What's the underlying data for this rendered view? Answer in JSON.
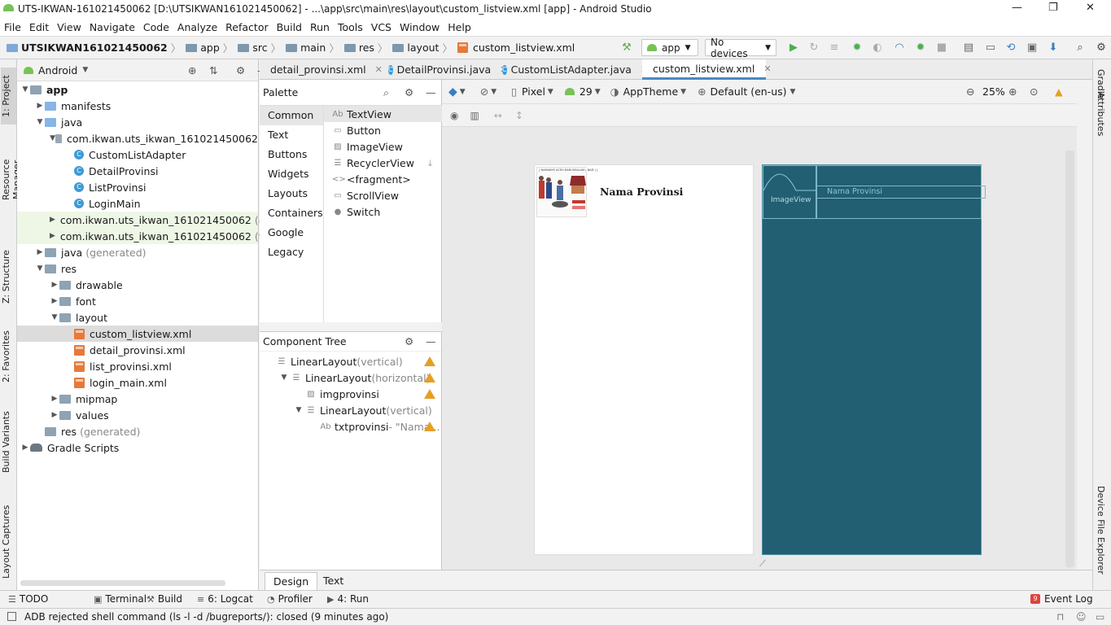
{
  "window": {
    "title": "UTS-IKWAN-161021450062 [D:\\UTSIKWAN161021450062] - ...\\app\\src\\main\\res\\layout\\custom_listview.xml [app] - Android Studio"
  },
  "menu": [
    "File",
    "Edit",
    "View",
    "Navigate",
    "Code",
    "Analyze",
    "Refactor",
    "Build",
    "Run",
    "Tools",
    "VCS",
    "Window",
    "Help"
  ],
  "breadcrumb": {
    "project": "UTSIKWAN161021450062",
    "parts": [
      "app",
      "src",
      "main",
      "res",
      "layout"
    ],
    "file": "custom_listview.xml"
  },
  "toolbar": {
    "run_config": "app",
    "device": "No devices"
  },
  "left_strip": [
    "1: Project",
    "Resource Manager",
    "Z: Structure",
    "2: Favorites",
    "Build Variants",
    "Layout Captures"
  ],
  "right_strip": [
    "Gradle",
    "Attributes",
    "Device File Explorer"
  ],
  "project": {
    "view_mode": "Android",
    "tree": [
      {
        "label": "app",
        "kind": "module",
        "indent": 0,
        "open": true
      },
      {
        "label": "manifests",
        "kind": "folder",
        "indent": 1,
        "open": false
      },
      {
        "label": "java",
        "kind": "folder",
        "indent": 1,
        "open": true
      },
      {
        "label": "com.ikwan.uts_ikwan_161021450062",
        "kind": "pkg",
        "indent": 2,
        "open": true
      },
      {
        "label": "CustomListAdapter",
        "kind": "class",
        "indent": 3
      },
      {
        "label": "DetailProvinsi",
        "kind": "class",
        "indent": 3
      },
      {
        "label": "ListProvinsi",
        "kind": "class",
        "indent": 3
      },
      {
        "label": "LoginMain",
        "kind": "class",
        "indent": 3
      },
      {
        "label": "com.ikwan.uts_ikwan_161021450062",
        "suffix": "(andr",
        "kind": "pkg",
        "indent": 2,
        "open": false,
        "green": true
      },
      {
        "label": "com.ikwan.uts_ikwan_161021450062",
        "suffix": "(test)",
        "kind": "pkg",
        "indent": 2,
        "open": false,
        "green": true
      },
      {
        "label": "java",
        "suffix": "(generated)",
        "kind": "folder",
        "indent": 1,
        "open": false
      },
      {
        "label": "res",
        "kind": "folder",
        "indent": 1,
        "open": true
      },
      {
        "label": "drawable",
        "kind": "folder",
        "indent": 2,
        "open": false
      },
      {
        "label": "font",
        "kind": "folder",
        "indent": 2,
        "open": false
      },
      {
        "label": "layout",
        "kind": "folder",
        "indent": 2,
        "open": true
      },
      {
        "label": "custom_listview.xml",
        "kind": "xml",
        "indent": 3,
        "selected": true
      },
      {
        "label": "detail_provinsi.xml",
        "kind": "xml",
        "indent": 3
      },
      {
        "label": "list_provinsi.xml",
        "kind": "xml",
        "indent": 3
      },
      {
        "label": "login_main.xml",
        "kind": "xml",
        "indent": 3
      },
      {
        "label": "mipmap",
        "kind": "folder",
        "indent": 2,
        "open": false
      },
      {
        "label": "values",
        "kind": "folder",
        "indent": 2,
        "open": false
      },
      {
        "label": "res",
        "suffix": "(generated)",
        "kind": "folder",
        "indent": 1,
        "leaf": true
      },
      {
        "label": "Gradle Scripts",
        "kind": "gradle",
        "indent": 0,
        "open": false
      }
    ]
  },
  "editor_tabs": [
    {
      "label": "detail_provinsi.xml",
      "kind": "xml"
    },
    {
      "label": "DetailProvinsi.java",
      "kind": "class"
    },
    {
      "label": "CustomListAdapter.java",
      "kind": "class"
    },
    {
      "label": "custom_listview.xml",
      "kind": "xml",
      "active": true
    }
  ],
  "palette": {
    "title": "Palette",
    "categories": [
      "Common",
      "Text",
      "Buttons",
      "Widgets",
      "Layouts",
      "Containers",
      "Google",
      "Legacy"
    ],
    "items": [
      {
        "label": "TextView",
        "icon": "Ab"
      },
      {
        "label": "Button",
        "icon": "▭"
      },
      {
        "label": "ImageView",
        "icon": "▨"
      },
      {
        "label": "RecyclerView",
        "icon": "☰"
      },
      {
        "label": "<fragment>",
        "icon": "<>"
      },
      {
        "label": "ScrollView",
        "icon": "▭"
      },
      {
        "label": "Switch",
        "icon": "●"
      }
    ]
  },
  "component_tree": {
    "title": "Component Tree",
    "items": [
      {
        "name": "LinearLayout",
        "extra": "(vertical)",
        "indent": 0,
        "warn": true
      },
      {
        "name": "LinearLayout",
        "extra": "(horizontal)",
        "indent": 1,
        "warn": true,
        "open": true
      },
      {
        "name": "imgprovinsi",
        "extra": "",
        "indent": 2,
        "warn": true
      },
      {
        "name": "LinearLayout",
        "extra": "(vertical)",
        "indent": 2,
        "open": true
      },
      {
        "name": "txtprovinsi",
        "extra": "- \"Nama...",
        "indent": 3,
        "warn": true
      }
    ]
  },
  "design_toolbar": {
    "device": "Pixel",
    "api": "29",
    "theme": "AppTheme",
    "locale": "Default (en-us)",
    "zoom": "25%"
  },
  "preview": {
    "text": "Nama Provinsi",
    "blueprint_image_label": "ImageView",
    "blueprint_text": "Nama Provinsi",
    "thumbnail_caption": "[ NAMANYE ACEH DARUSSALAM ( NAD ) ]"
  },
  "bottom_tabs": [
    "Design",
    "Text"
  ],
  "tool_windows": [
    {
      "label": "TODO",
      "icon": "☰"
    },
    {
      "label": "Terminal",
      "icon": "▣"
    },
    {
      "label": "Build",
      "icon": "⚒"
    },
    {
      "label": "6: Logcat",
      "icon": "≡"
    },
    {
      "label": "Profiler",
      "icon": "◔"
    },
    {
      "label": "4: Run",
      "icon": "▶"
    }
  ],
  "event_log": {
    "count": "9",
    "label": "Event Log"
  },
  "status": "ADB rejected shell command (ls -l -d /bugreports/): closed (9 minutes ago)",
  "colors": {
    "blueprint": "#225f73",
    "accent": "#4a88c7",
    "warn": "#e5a023",
    "run": "#4caf50"
  }
}
